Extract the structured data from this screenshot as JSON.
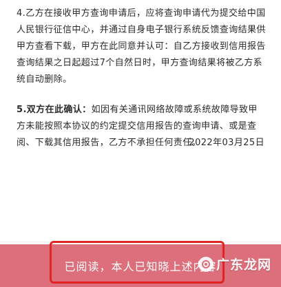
{
  "agreement": {
    "clause4": "4.乙方在接收甲方查询申请后，应将查询申请代为提交给中国人民银行征信中心，并通过自身电子银行系统反馈查询结果供甲方查看下载，甲方在此同意并认可：自乙方接收到信用报告查询结果之日起超过7个自然日时，甲方查询结果将被乙方系统自动删除。",
    "clause5_lead": "5.双方在此确认：",
    "clause5_body": "如因有关通讯网络故障或系统故障导致甲方未能按照本协议的约定提交信用报告的查询申请、或是查阅、下载其信用报告，乙方不承担任何责任。",
    "date": "2022年03月25日"
  },
  "footer": {
    "confirm_label": "已阅读，本人已知晓上述内容",
    "watermark_text": "广东龙网"
  },
  "colors": {
    "bar": "#dd6e7b",
    "highlight": "#e32222"
  }
}
